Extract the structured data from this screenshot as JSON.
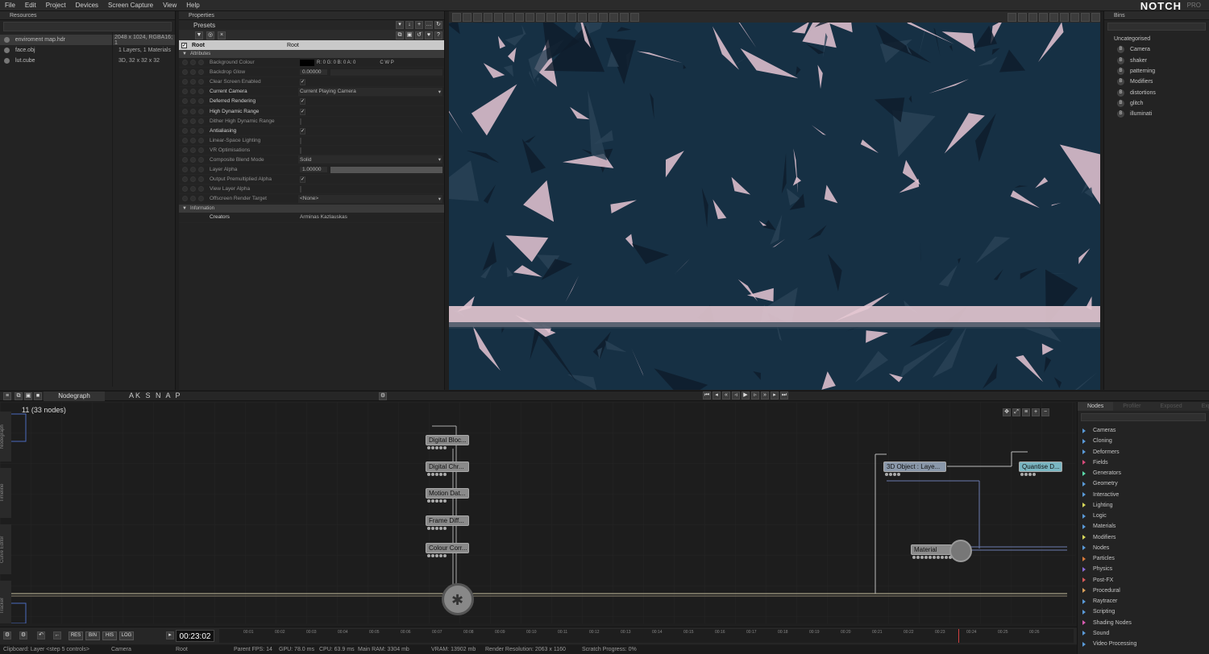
{
  "menu": [
    "File",
    "Edit",
    "Project",
    "Devices",
    "Screen Capture",
    "View",
    "Help"
  ],
  "app": {
    "logo": "NOTCH",
    "edition": "PRO"
  },
  "resources": {
    "title": "Resources",
    "items": [
      {
        "name": "enviroment map.hdr",
        "detail": "2048 x 1024, RGBA16; 1"
      },
      {
        "name": "face.obj",
        "detail": "1 Layers, 1 Materials"
      },
      {
        "name": "lut.cube",
        "detail": "3D, 32 x 32 x 32"
      }
    ]
  },
  "properties": {
    "title": "Properties",
    "presets": "Presets",
    "root_name": "Root",
    "root_type": "Root",
    "attributes_label": "Attributes",
    "rows": [
      {
        "label": "Background Colour",
        "value": "R: 0 G: 0 B: 0 A: 0",
        "extra": "C  W  P",
        "kind": "color",
        "hi": false
      },
      {
        "label": "Backdrop Glow",
        "value": "0.00000",
        "kind": "num",
        "hi": false
      },
      {
        "label": "Clear Screen Enabled",
        "value": "✓",
        "kind": "check",
        "hi": false
      },
      {
        "label": "Current Camera",
        "value": "Current Playing Camera",
        "kind": "select",
        "hi": true
      },
      {
        "label": "Deferred Rendering",
        "value": "✓",
        "kind": "check",
        "hi": true
      },
      {
        "label": "High Dynamic Range",
        "value": "✓",
        "kind": "check",
        "hi": true
      },
      {
        "label": "Dither High Dynamic Range",
        "value": "",
        "kind": "check",
        "hi": false
      },
      {
        "label": "Antialiasing",
        "value": "✓",
        "kind": "check",
        "hi": true
      },
      {
        "label": "Linear-Space Lighting",
        "value": "",
        "kind": "check",
        "hi": false
      },
      {
        "label": "VR Optimisations",
        "value": "",
        "kind": "check",
        "hi": false
      },
      {
        "label": "Composite Blend Mode",
        "value": "Solid",
        "kind": "select",
        "hi": false
      },
      {
        "label": "Layer Alpha",
        "value": "1.00000",
        "kind": "num",
        "hi": false
      },
      {
        "label": "Output Premultiplied Alpha",
        "value": "✓",
        "kind": "check",
        "hi": false
      },
      {
        "label": "View Layer Alpha",
        "value": "",
        "kind": "check",
        "hi": false
      },
      {
        "label": "Offscreen Render Target",
        "value": "<None>",
        "kind": "select",
        "hi": false
      }
    ],
    "information_label": "Information",
    "creators_label": "Creators",
    "creators_value": "Arminas Kazlauskas"
  },
  "bins": {
    "title": "Bins",
    "category": "Uncategorised",
    "items": [
      "Camera",
      "shaker",
      "patterning",
      "Modifiers",
      "distortions",
      "glitch",
      "illuminati"
    ]
  },
  "nodegraph": {
    "tab": "Nodegraph",
    "tools": "AK S N A P",
    "layer_info": "11  (33  nodes)",
    "nodes": [
      "Digital  Bloc...",
      "Digital  Chr...",
      "Motion  Dat...",
      "Frame  Diff...",
      "Colour  Corr...",
      "3D  Object  :  Laye...",
      "Quantise  D...",
      "Material"
    ]
  },
  "node_panel": {
    "tabs": [
      "Nodes",
      "Profiler",
      "Exposed",
      "Exposed"
    ],
    "categories": [
      "Cameras",
      "Cloning",
      "Deformers",
      "Fields",
      "Generators",
      "Geometry",
      "Interactive",
      "Lighting",
      "Logic",
      "Materials",
      "Modifiers",
      "Nodes",
      "Particles",
      "Physics",
      "Post-FX",
      "Procedural",
      "Raytracer",
      "Scripting",
      "Shading Nodes",
      "Sound",
      "Video Processing"
    ],
    "category_colors": [
      "#5a9ad8",
      "#5a9ad8",
      "#5a9ad8",
      "#d84a7a",
      "#5ad8a8",
      "#5a9ad8",
      "#5a9ad8",
      "#d8d85a",
      "#5a9ad8",
      "#5a9ad8",
      "#d8d85a",
      "#5a9ad8",
      "#d87a3a",
      "#8a6ad8",
      "#d85a5a",
      "#d8a05a",
      "#5a9ad8",
      "#5a9ad8",
      "#d85ab0",
      "#5a9ad8",
      "#5a9ad8"
    ]
  },
  "timeline": {
    "buttons": [
      "RES",
      "BIN",
      "HIS",
      "LOG"
    ],
    "timecode": "00:23:02",
    "ticks": [
      "00:01",
      "00:02",
      "00:03",
      "00:04",
      "00:05",
      "00:06",
      "00:07",
      "00:08",
      "00:09",
      "00:10",
      "00:11",
      "00:12",
      "00:13",
      "00:14",
      "00:15",
      "00:16",
      "00:17",
      "00:18",
      "00:19",
      "00:20",
      "00:21",
      "00:22",
      "00:23",
      "00:24",
      "00:25",
      "00:26"
    ]
  },
  "status": {
    "clipboard": "Clipboard: Layer <step 5 controls>",
    "camera": "Camera",
    "root": "Root",
    "fps": "Parent FPS: 14",
    "gpu": "GPU: 78.0 ms",
    "cpu": "CPU: 63.9 ms",
    "ram": "Main RAM: 3304 mb",
    "vram": "VRAM: 13902 mb",
    "res": "Render Resolution: 2063 x 1160",
    "scratch": "Scratch Progress: 0%"
  },
  "side_tabs": [
    "Nodegraph",
    "Timeline",
    "Curve Editor",
    "Tracker"
  ],
  "colors": {
    "viewport_dark": "#142638",
    "viewport_light": "#e6c6d4"
  }
}
